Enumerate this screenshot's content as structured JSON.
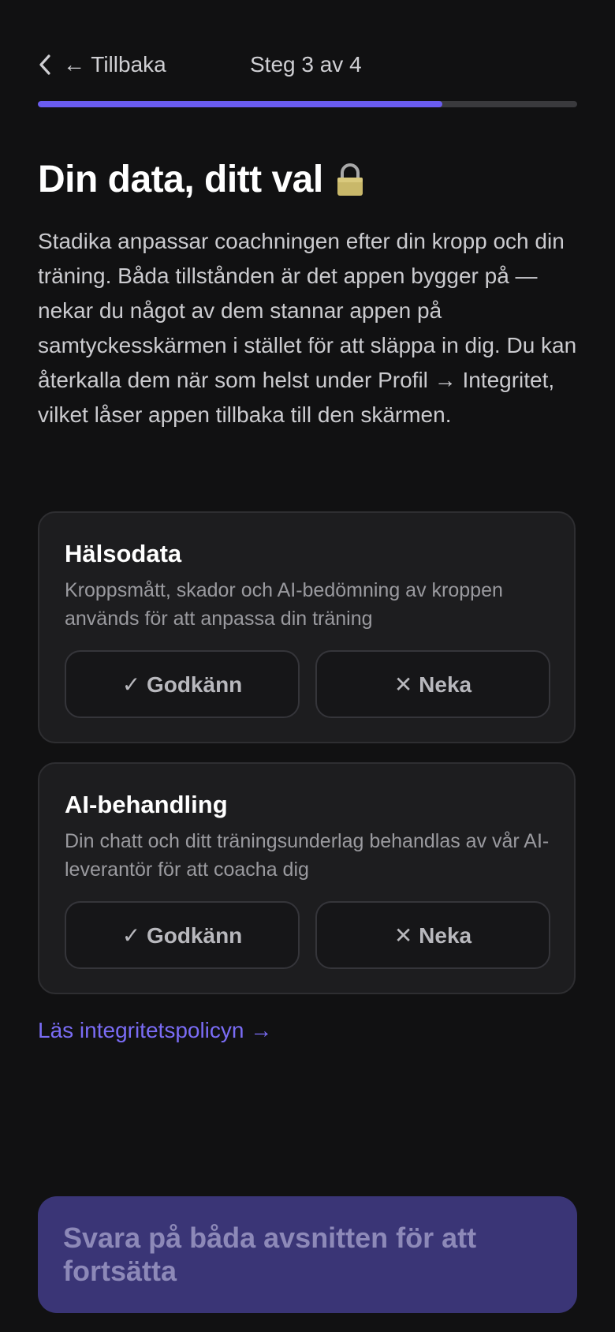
{
  "header": {
    "back_label": "← Tillbaka",
    "step_label": "Steg 3 av 4",
    "progress_fraction": 0.75
  },
  "page": {
    "title": "Din data, ditt val",
    "intro": "Stadika anpassar coachningen efter din kropp och din träning. Båda tillstånden är det appen bygger på — nekar du något av dem stannar appen på samtyckesskärmen i stället för att släppa in dig. Du kan återkalla dem när som helst under Profil → Integritet, vilket låser appen tillbaka till den skärmen."
  },
  "consents": [
    {
      "title": "Hälsodata",
      "description": "Kroppsmått, skador och AI-bedömning av kroppen används för att anpassa din träning",
      "approve_label": "✓ Godkänn",
      "deny_label": "✕ Neka"
    },
    {
      "title": "AI-behandling",
      "description": "Din chatt och ditt träningsunderlag behandlas av vår AI-leverantör för att coacha dig",
      "approve_label": "✓ Godkänn",
      "deny_label": "✕ Neka"
    }
  ],
  "policy_link": "Läs integritetspolicyn →",
  "cta_label": "Svara på båda avsnitten för att fortsätta",
  "colors": {
    "background": "#111112",
    "accent": "#6a5cf0",
    "card": "#1d1d1f",
    "cta_disabled": "#3a3576"
  },
  "icons": [
    "chevron-left-icon",
    "lock-icon"
  ]
}
